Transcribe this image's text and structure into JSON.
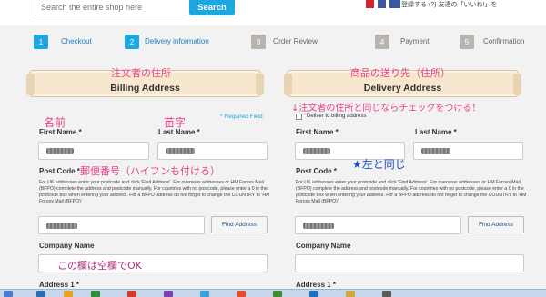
{
  "search": {
    "placeholder": "Search the entire shop here",
    "button_label": "Search"
  },
  "social": {
    "text": "登録する (?)  友達の「いいね!」を"
  },
  "steps": [
    {
      "num": "1",
      "label": "Checkout",
      "active": true
    },
    {
      "num": "2",
      "label": "Delivery information",
      "active": true
    },
    {
      "num": "3",
      "label": "Order Review",
      "active": false
    },
    {
      "num": "4",
      "label": "Payment",
      "active": false
    },
    {
      "num": "5",
      "label": "Confirmation",
      "active": false
    }
  ],
  "billing": {
    "note_jp": "注文者の住所",
    "title": "Billing Address",
    "required": "* Required Field",
    "first_name_note": "名前",
    "last_name_note": "苗字",
    "first_name_label": "First Name *",
    "last_name_label": "Last Name *",
    "post_code_label": "Post Code *",
    "post_code_note": "郵便番号（ハイフンも付ける）",
    "help_text": "For UK addresses enter your postcode and click 'Find Address'. For overseas addresses or HM Forces Mail (BFPO) complete the address and postcode manually. For countries with no postcode, please enter a 0 in the postcode box when entering your address. For a BFPO address do not forget to change the COUNTRY to 'HM Forces Mail (BFPO)'",
    "find_address": "Find Address",
    "company_label": "Company Name",
    "company_note": "この欄は空欄でOK",
    "address1_label": "Address 1 *"
  },
  "delivery": {
    "note_jp": "商品の送り先（住所）",
    "title": "Delivery Address",
    "checkbox_note": "↓注文者の住所と同じならチェックをつける！",
    "checkbox_label": "Deliver to billing address",
    "required": "* Required Field",
    "same_note": "★左と同じ",
    "first_name_label": "First Name *",
    "last_name_label": "Last Name *",
    "post_code_label": "Post Code *",
    "help_text": "For UK addresses enter your postcode and click 'Find Address'. For overseas addresses or HM Forces Mail (BFPO) complete the address and postcode manually. For countries with no postcode, please enter a 0 in the postcode box when entering your address. For a BFPO address do not forget to change the COUNTRY to 'HM Forces Mail (BFPO)'",
    "find_address": "Find Address",
    "company_label": "Company Name",
    "address1_label": "Address 1 *"
  },
  "colors": {
    "accent": "#1ea6df",
    "annotation_pink": "#e8408a",
    "annotation_blue": "#1a4fc4"
  }
}
